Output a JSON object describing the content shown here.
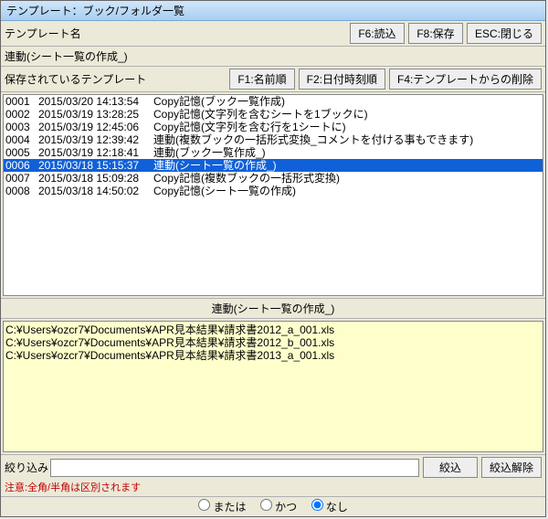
{
  "title": "テンプレート：ブック/フォルダ一覧",
  "header": {
    "templateNameLabel": "テンプレート名",
    "btnLoad": "F6:読込",
    "btnSave": "F8:保存",
    "btnClose": "ESC:閉じる"
  },
  "currentTemplate": "連動(シート一覧の作成_)",
  "savedHeader": {
    "label": "保存されているテンプレート",
    "btnName": "F1:名前順",
    "btnDate": "F2:日付時刻順",
    "btnDelete": "F4:テンプレートからの削除"
  },
  "rows": [
    {
      "id": "0001",
      "ts": "2015/03/20 14:13:54",
      "name": "Copy記憶(ブック一覧作成)",
      "sel": false
    },
    {
      "id": "0002",
      "ts": "2015/03/19 13:28:25",
      "name": "Copy記憶(文字列を含むシートを1ブックに)",
      "sel": false
    },
    {
      "id": "0003",
      "ts": "2015/03/19 12:45:06",
      "name": "Copy記憶(文字列を含む行を1シートに)",
      "sel": false
    },
    {
      "id": "0004",
      "ts": "2015/03/19 12:39:42",
      "name": "連動(複数ブックの一括形式変換_コメントを付ける事もできます)",
      "sel": false
    },
    {
      "id": "0005",
      "ts": "2015/03/19 12:18:41",
      "name": "連動(ブック一覧作成_)",
      "sel": false
    },
    {
      "id": "0006",
      "ts": "2015/03/18 15:15:37",
      "name": "連動(シート一覧の作成_)",
      "sel": true
    },
    {
      "id": "0007",
      "ts": "2015/03/18 15:09:28",
      "name": "Copy記憶(複数ブックの一括形式変換)",
      "sel": false
    },
    {
      "id": "0008",
      "ts": "2015/03/18 14:50:02",
      "name": "Copy記憶(シート一覧の作成)",
      "sel": false
    }
  ],
  "midHeader": "連動(シート一覧の作成_)",
  "details": [
    "C:¥Users¥ozcr7¥Documents¥APR見本結果¥請求書2012_a_001.xls",
    "C:¥Users¥ozcr7¥Documents¥APR見本結果¥請求書2012_b_001.xls",
    "C:¥Users¥ozcr7¥Documents¥APR見本結果¥請求書2013_a_001.xls"
  ],
  "filter": {
    "label": "絞り込み",
    "value": "",
    "btnApply": "絞込",
    "btnClear": "絞込解除",
    "note": "注意:全角/半角は区別されます"
  },
  "radios": {
    "or": "または",
    "and": "かつ",
    "none": "なし",
    "selected": "none"
  }
}
